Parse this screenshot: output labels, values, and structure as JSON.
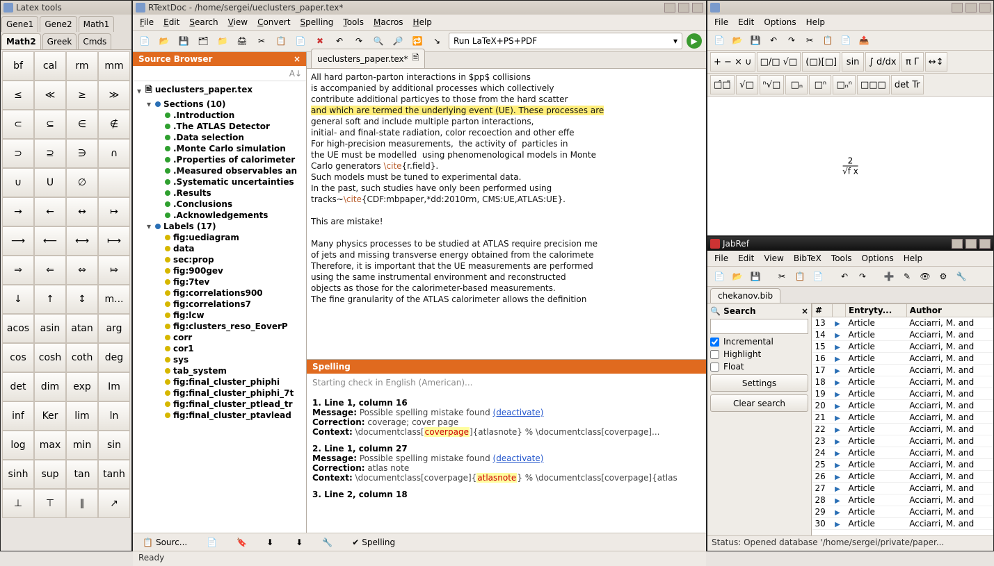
{
  "latextools": {
    "title": "Latex tools",
    "tabs_row1": [
      "Gene1",
      "Gene2",
      "Math1"
    ],
    "tabs_row2": [
      "Math2",
      "Greek",
      "Cmds"
    ],
    "active_tab": "Math2",
    "symbols": [
      "bf",
      "cal",
      "rm",
      "mm",
      "≤",
      "≪",
      "≥",
      "≫",
      "⊂",
      "⊆",
      "∈",
      "∉",
      "⊃",
      "⊇",
      "∋",
      "∩",
      "∪",
      "U",
      "∅",
      "",
      "→",
      "←",
      "↔",
      "↦",
      "⟶",
      "⟵",
      "⟷",
      "⟼",
      "⇒",
      "⇐",
      "⇔",
      "⤇",
      "↓",
      "↑",
      "↕",
      "m...",
      "acos",
      "asin",
      "atan",
      "arg",
      "cos",
      "cosh",
      "coth",
      "deg",
      "det",
      "dim",
      "exp",
      "Im",
      "inf",
      "Ker",
      "lim",
      "ln",
      "log",
      "max",
      "min",
      "sin",
      "sinh",
      "sup",
      "tan",
      "tanh",
      "⊥",
      "⊤",
      "∥",
      "↗"
    ]
  },
  "rtextdoc": {
    "title": "RTextDoc - /home/sergei/ueclusters_paper.tex*",
    "menus": [
      "File",
      "Edit",
      "Search",
      "View",
      "Convert",
      "Spelling",
      "Tools",
      "Macros",
      "Help"
    ],
    "run_label": "Run LaTeX+PS+PDF",
    "source_browser_title": "Source Browser",
    "file_tab": "ueclusters_paper.tex*",
    "tree_root": "ueclusters_paper.tex",
    "sections_label": "Sections (10)",
    "sections": [
      ".Introduction",
      ".The ATLAS Detector",
      ".Data selection",
      ".Monte Carlo simulation",
      ".Properties of calorimeter",
      ".Measured observables an",
      ".Systematic uncertainties",
      ".Results",
      ".Conclusions",
      ".Acknowledgements"
    ],
    "labels_label": "Labels (17)",
    "labels": [
      "fig:uediagram",
      "data",
      "sec:prop",
      "fig:900gev",
      "fig:7tev",
      "fig:correlations900",
      "fig:correlations7",
      "fig:lcw",
      "fig:clusters_reso_EoverP",
      "corr",
      "cor1",
      "sys",
      "tab_system",
      "fig:final_cluster_phiphi",
      "fig:final_cluster_phiphi_7t",
      "fig:final_cluster_ptlead_tr",
      "fig:final_cluster_ptavlead"
    ],
    "editor_lines": [
      {
        "t": "All hard parton-parton interactions in $pp$ collisions"
      },
      {
        "t": "is accompanied by additional processes which collectively"
      },
      {
        "t": "contribute additional particyes to those from the hard scatter",
        "hl": false
      },
      {
        "t": "and which are termed the underlying event (UE). These processes are",
        "hl": true
      },
      {
        "t": "general soft and include multiple parton interactions,"
      },
      {
        "t": "initial- and final-state radiation, color recoection and other effe"
      },
      {
        "t": "For high-precision measurements,  the activity of  particles in"
      },
      {
        "t": "the UE must be modelled  using phenomenological models in Monte"
      },
      {
        "t": "Carlo generators \\cite{r.field}."
      },
      {
        "t": "Such models must be tuned to experimental data."
      },
      {
        "t": "In the past, such studies have only been performed using"
      },
      {
        "t": "tracks~\\cite{CDF:mbpaper,*dd:2010rm, CMS:UE,ATLAS:UE}."
      },
      {
        "t": ""
      },
      {
        "t": "This are mistake!"
      },
      {
        "t": ""
      },
      {
        "t": "Many physics processes to be studied at ATLAS require precision me"
      },
      {
        "t": "of jets and missing transverse energy obtained from the calorimete"
      },
      {
        "t": "Therefore, it is important that the UE measurements are performed"
      },
      {
        "t": "using the same instrumental environment and reconstructed"
      },
      {
        "t": "objects as those for the calorimeter-based measurements."
      },
      {
        "t": "The fine granularity of the ATLAS calorimeter allows the definition"
      }
    ],
    "spelling_title": "Spelling",
    "spell_start": "Starting check in English (American)...",
    "spell_items": [
      {
        "loc": "1. Line 1, column 16",
        "msg": "Possible spelling mistake found",
        "deact": "(deactivate)",
        "corr": "coverage; cover page",
        "ctx_pre": "\\documentclass[",
        "ctx_hl": "coverpage",
        "ctx_post": "]{atlasnote} % \\documentclass[coverpage]..."
      },
      {
        "loc": "2. Line 1, column 27",
        "msg": "Possible spelling mistake found",
        "deact": "(deactivate)",
        "corr": "atlas note",
        "ctx_pre": "\\documentclass[coverpage]{",
        "ctx_hl": "atlasnote",
        "ctx_post": "} % \\documentclass[coverpage]{atlas"
      },
      {
        "loc": "3. Line 2, column 18",
        "msg": "",
        "deact": "",
        "corr": "",
        "ctx_pre": "",
        "ctx_hl": "",
        "ctx_post": ""
      }
    ],
    "bottom_tabs": [
      "Sourc...",
      "",
      "",
      "Spelling"
    ],
    "status": "Ready",
    "labels_ui": {
      "message": "Message:",
      "correction": "Correction:",
      "context": "Context:"
    }
  },
  "javawin": {
    "menus": [
      "File",
      "Edit",
      "Options",
      "Help"
    ],
    "row1": [
      "+ −\n× ∪",
      "□/□ √□",
      "(□)[□]",
      "sin",
      "∫ d/dx",
      "π Γ",
      "↔↕"
    ],
    "row2": [
      "□̂□̃",
      "√□",
      "ⁿ√□",
      "□ₙ",
      "□ⁿ",
      "□ₙⁿ",
      "□□□",
      "det Tr"
    ],
    "formula_top": "2",
    "formula_bottom": "√f x"
  },
  "jabref": {
    "title": "JabRef",
    "menus": [
      "File",
      "Edit",
      "View",
      "BibTeX",
      "Tools",
      "Options",
      "Help"
    ],
    "bib_tab": "chekanov.bib",
    "search_label": "Search",
    "incremental": "Incremental",
    "highlight": "Highlight",
    "float": "Float",
    "settings": "Settings",
    "clear": "Clear search",
    "columns": [
      "#",
      "",
      "Entryty...",
      "Author"
    ],
    "rows": [
      {
        "n": 13,
        "t": "Article",
        "a": "Acciarri, M. and"
      },
      {
        "n": 14,
        "t": "Article",
        "a": "Acciarri, M. and"
      },
      {
        "n": 15,
        "t": "Article",
        "a": "Acciarri, M. and"
      },
      {
        "n": 16,
        "t": "Article",
        "a": "Acciarri, M. and"
      },
      {
        "n": 17,
        "t": "Article",
        "a": "Acciarri, M. and"
      },
      {
        "n": 18,
        "t": "Article",
        "a": "Acciarri, M. and"
      },
      {
        "n": 19,
        "t": "Article",
        "a": "Acciarri, M. and"
      },
      {
        "n": 20,
        "t": "Article",
        "a": "Acciarri, M. and"
      },
      {
        "n": 21,
        "t": "Article",
        "a": "Acciarri, M. and"
      },
      {
        "n": 22,
        "t": "Article",
        "a": "Acciarri, M. and"
      },
      {
        "n": 23,
        "t": "Article",
        "a": "Acciarri, M. and"
      },
      {
        "n": 24,
        "t": "Article",
        "a": "Acciarri, M. and"
      },
      {
        "n": 25,
        "t": "Article",
        "a": "Acciarri, M. and"
      },
      {
        "n": 26,
        "t": "Article",
        "a": "Acciarri, M. and"
      },
      {
        "n": 27,
        "t": "Article",
        "a": "Acciarri, M. and"
      },
      {
        "n": 28,
        "t": "Article",
        "a": "Acciarri, M. and"
      },
      {
        "n": 29,
        "t": "Article",
        "a": "Acciarri, M. and"
      },
      {
        "n": 30,
        "t": "Article",
        "a": "Acciarri, M. and"
      }
    ],
    "status": "Status: Opened database '/home/sergei/private/paper..."
  }
}
